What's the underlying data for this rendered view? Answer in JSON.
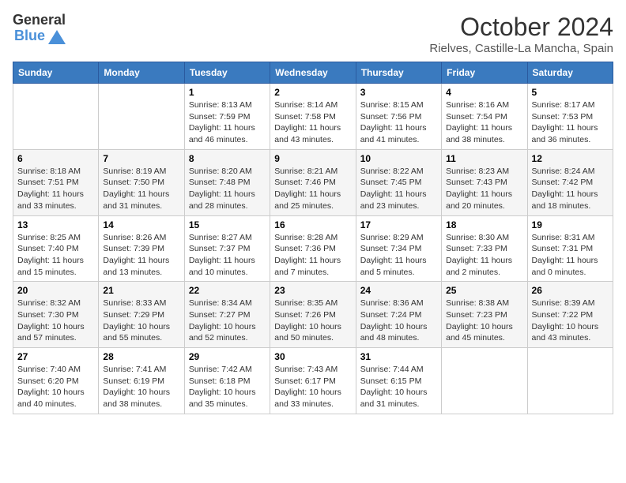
{
  "logo": {
    "text_general": "General",
    "text_blue": "Blue"
  },
  "header": {
    "month": "October 2024",
    "location": "Rielves, Castille-La Mancha, Spain"
  },
  "weekdays": [
    "Sunday",
    "Monday",
    "Tuesday",
    "Wednesday",
    "Thursday",
    "Friday",
    "Saturday"
  ],
  "weeks": [
    [
      {
        "day": "",
        "info": ""
      },
      {
        "day": "",
        "info": ""
      },
      {
        "day": "1",
        "info": "Sunrise: 8:13 AM\nSunset: 7:59 PM\nDaylight: 11 hours and 46 minutes."
      },
      {
        "day": "2",
        "info": "Sunrise: 8:14 AM\nSunset: 7:58 PM\nDaylight: 11 hours and 43 minutes."
      },
      {
        "day": "3",
        "info": "Sunrise: 8:15 AM\nSunset: 7:56 PM\nDaylight: 11 hours and 41 minutes."
      },
      {
        "day": "4",
        "info": "Sunrise: 8:16 AM\nSunset: 7:54 PM\nDaylight: 11 hours and 38 minutes."
      },
      {
        "day": "5",
        "info": "Sunrise: 8:17 AM\nSunset: 7:53 PM\nDaylight: 11 hours and 36 minutes."
      }
    ],
    [
      {
        "day": "6",
        "info": "Sunrise: 8:18 AM\nSunset: 7:51 PM\nDaylight: 11 hours and 33 minutes."
      },
      {
        "day": "7",
        "info": "Sunrise: 8:19 AM\nSunset: 7:50 PM\nDaylight: 11 hours and 31 minutes."
      },
      {
        "day": "8",
        "info": "Sunrise: 8:20 AM\nSunset: 7:48 PM\nDaylight: 11 hours and 28 minutes."
      },
      {
        "day": "9",
        "info": "Sunrise: 8:21 AM\nSunset: 7:46 PM\nDaylight: 11 hours and 25 minutes."
      },
      {
        "day": "10",
        "info": "Sunrise: 8:22 AM\nSunset: 7:45 PM\nDaylight: 11 hours and 23 minutes."
      },
      {
        "day": "11",
        "info": "Sunrise: 8:23 AM\nSunset: 7:43 PM\nDaylight: 11 hours and 20 minutes."
      },
      {
        "day": "12",
        "info": "Sunrise: 8:24 AM\nSunset: 7:42 PM\nDaylight: 11 hours and 18 minutes."
      }
    ],
    [
      {
        "day": "13",
        "info": "Sunrise: 8:25 AM\nSunset: 7:40 PM\nDaylight: 11 hours and 15 minutes."
      },
      {
        "day": "14",
        "info": "Sunrise: 8:26 AM\nSunset: 7:39 PM\nDaylight: 11 hours and 13 minutes."
      },
      {
        "day": "15",
        "info": "Sunrise: 8:27 AM\nSunset: 7:37 PM\nDaylight: 11 hours and 10 minutes."
      },
      {
        "day": "16",
        "info": "Sunrise: 8:28 AM\nSunset: 7:36 PM\nDaylight: 11 hours and 7 minutes."
      },
      {
        "day": "17",
        "info": "Sunrise: 8:29 AM\nSunset: 7:34 PM\nDaylight: 11 hours and 5 minutes."
      },
      {
        "day": "18",
        "info": "Sunrise: 8:30 AM\nSunset: 7:33 PM\nDaylight: 11 hours and 2 minutes."
      },
      {
        "day": "19",
        "info": "Sunrise: 8:31 AM\nSunset: 7:31 PM\nDaylight: 11 hours and 0 minutes."
      }
    ],
    [
      {
        "day": "20",
        "info": "Sunrise: 8:32 AM\nSunset: 7:30 PM\nDaylight: 10 hours and 57 minutes."
      },
      {
        "day": "21",
        "info": "Sunrise: 8:33 AM\nSunset: 7:29 PM\nDaylight: 10 hours and 55 minutes."
      },
      {
        "day": "22",
        "info": "Sunrise: 8:34 AM\nSunset: 7:27 PM\nDaylight: 10 hours and 52 minutes."
      },
      {
        "day": "23",
        "info": "Sunrise: 8:35 AM\nSunset: 7:26 PM\nDaylight: 10 hours and 50 minutes."
      },
      {
        "day": "24",
        "info": "Sunrise: 8:36 AM\nSunset: 7:24 PM\nDaylight: 10 hours and 48 minutes."
      },
      {
        "day": "25",
        "info": "Sunrise: 8:38 AM\nSunset: 7:23 PM\nDaylight: 10 hours and 45 minutes."
      },
      {
        "day": "26",
        "info": "Sunrise: 8:39 AM\nSunset: 7:22 PM\nDaylight: 10 hours and 43 minutes."
      }
    ],
    [
      {
        "day": "27",
        "info": "Sunrise: 7:40 AM\nSunset: 6:20 PM\nDaylight: 10 hours and 40 minutes."
      },
      {
        "day": "28",
        "info": "Sunrise: 7:41 AM\nSunset: 6:19 PM\nDaylight: 10 hours and 38 minutes."
      },
      {
        "day": "29",
        "info": "Sunrise: 7:42 AM\nSunset: 6:18 PM\nDaylight: 10 hours and 35 minutes."
      },
      {
        "day": "30",
        "info": "Sunrise: 7:43 AM\nSunset: 6:17 PM\nDaylight: 10 hours and 33 minutes."
      },
      {
        "day": "31",
        "info": "Sunrise: 7:44 AM\nSunset: 6:15 PM\nDaylight: 10 hours and 31 minutes."
      },
      {
        "day": "",
        "info": ""
      },
      {
        "day": "",
        "info": ""
      }
    ]
  ]
}
